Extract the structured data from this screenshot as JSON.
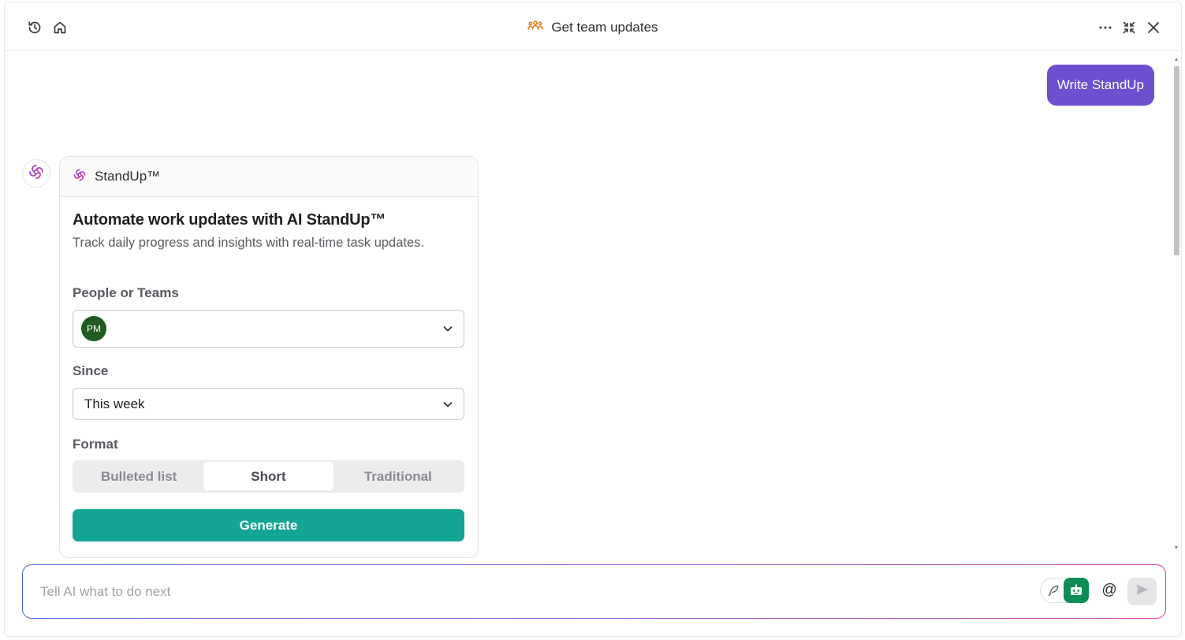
{
  "header": {
    "title": "Get team updates",
    "icons": {
      "history": "history-icon",
      "home": "home-icon",
      "team": "team-icon",
      "more": "more-icon",
      "collapse": "collapse-icon",
      "close": "close-icon"
    }
  },
  "chat": {
    "user_message": "Write StandUp",
    "card": {
      "header_label": "StandUp™",
      "title": "Automate work updates with AI StandUp™",
      "subtitle": "Track daily progress and insights with real-time task updates.",
      "people_label": "People or Teams",
      "people_avatar": "PM",
      "since_label": "Since",
      "since_value": "This week",
      "format_label": "Format",
      "format_options": [
        "Bulleted list",
        "Short",
        "Traditional"
      ],
      "format_selected": "Short",
      "generate_label": "Generate"
    }
  },
  "input": {
    "placeholder": "Tell AI what to do next",
    "value": "",
    "at_symbol": "@"
  },
  "colors": {
    "accent_purple": "#6d4fcf",
    "generate_teal": "#14a594",
    "agent_green": "#0c8d56",
    "team_orange": "#e07b1a"
  }
}
